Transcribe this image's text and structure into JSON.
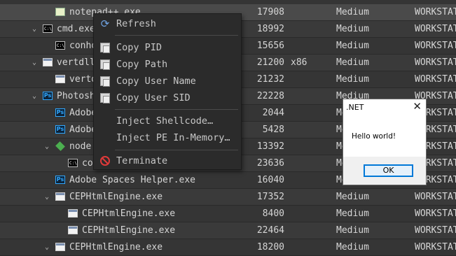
{
  "process_rows": [
    {
      "name": "notepad++.exe",
      "pid": "17908",
      "arch": "",
      "integrity": "Medium",
      "user": "WORKSTAT",
      "icon": "notepad-icon",
      "depth": 2,
      "chevron": ""
    },
    {
      "name": "cmd.exe",
      "pid": "18992",
      "arch": "",
      "integrity": "Medium",
      "user": "WORKSTAT",
      "icon": "console-icon",
      "depth": 1,
      "chevron": "down"
    },
    {
      "name": "conhost.exe",
      "pid": "15656",
      "arch": "",
      "integrity": "Medium",
      "user": "WORKSTAT",
      "icon": "console-icon",
      "depth": 2,
      "chevron": ""
    },
    {
      "name": "vertdll.exe",
      "pid": "21200",
      "arch": "x86",
      "integrity": "Medium",
      "user": "WORKSTAT",
      "icon": "window-icon",
      "depth": 1,
      "chevron": "down"
    },
    {
      "name": "vertdll.exe",
      "pid": "21232",
      "arch": "",
      "integrity": "Medium",
      "user": "WORKSTAT",
      "icon": "window-icon",
      "depth": 2,
      "chevron": ""
    },
    {
      "name": "Photoshop.exe",
      "pid": "22228",
      "arch": "",
      "integrity": "Medium",
      "user": "WORKSTAT",
      "icon": "photoshop-icon",
      "depth": 1,
      "chevron": "down"
    },
    {
      "name": "Adobe",
      "pid": "2044",
      "arch": "",
      "integrity": "Medium",
      "user": "WORKSTAT",
      "icon": "photoshop-icon",
      "depth": 2,
      "chevron": ""
    },
    {
      "name": "Adobe",
      "pid": "5428",
      "arch": "",
      "integrity": "Medium",
      "user": "WORKSTAT",
      "icon": "photoshop-icon",
      "depth": 2,
      "chevron": ""
    },
    {
      "name": "node.exe",
      "pid": "13392",
      "arch": "",
      "integrity": "Medium",
      "user": "WORKSTAT",
      "icon": "node-icon",
      "depth": 2,
      "chevron": "down"
    },
    {
      "name": "conhost.exe",
      "pid": "23636",
      "arch": "",
      "integrity": "Medium",
      "user": "WORKSTAT",
      "icon": "console-icon",
      "depth": 3,
      "chevron": ""
    },
    {
      "name": "Adobe Spaces Helper.exe",
      "pid": "16040",
      "arch": "",
      "integrity": "Medium",
      "user": "WORKSTAT",
      "icon": "photoshop-icon",
      "depth": 2,
      "chevron": ""
    },
    {
      "name": "CEPHtmlEngine.exe",
      "pid": "17352",
      "arch": "",
      "integrity": "Medium",
      "user": "WORKSTAT",
      "icon": "window-icon",
      "depth": 2,
      "chevron": "down"
    },
    {
      "name": "CEPHtmlEngine.exe",
      "pid": "8400",
      "arch": "",
      "integrity": "Medium",
      "user": "WORKSTAT",
      "icon": "window-icon",
      "depth": 3,
      "chevron": ""
    },
    {
      "name": "CEPHtmlEngine.exe",
      "pid": "22464",
      "arch": "",
      "integrity": "Medium",
      "user": "WORKSTAT",
      "icon": "window-icon",
      "depth": 3,
      "chevron": ""
    },
    {
      "name": "CEPHtmlEngine.exe",
      "pid": "18200",
      "arch": "",
      "integrity": "Medium",
      "user": "WORKSTAT",
      "icon": "window-icon",
      "depth": 2,
      "chevron": "down"
    }
  ],
  "context_menu": {
    "refresh": "Refresh",
    "copy_pid": "Copy PID",
    "copy_path": "Copy Path",
    "copy_user_name": "Copy User Name",
    "copy_user_sid": "Copy User SID",
    "inject_shellcode": "Inject Shellcode…",
    "inject_pe": "Inject PE In-Memory…",
    "terminate": "Terminate"
  },
  "message_box": {
    "title": ".NET",
    "message": "Hello world!",
    "ok_label": "OK",
    "close_glyph": "✕"
  },
  "colors": {
    "background": "#353535",
    "menu_background": "#2b2b2b",
    "accent_button_border": "#0078d7",
    "terminate_icon": "#e03a3a"
  }
}
